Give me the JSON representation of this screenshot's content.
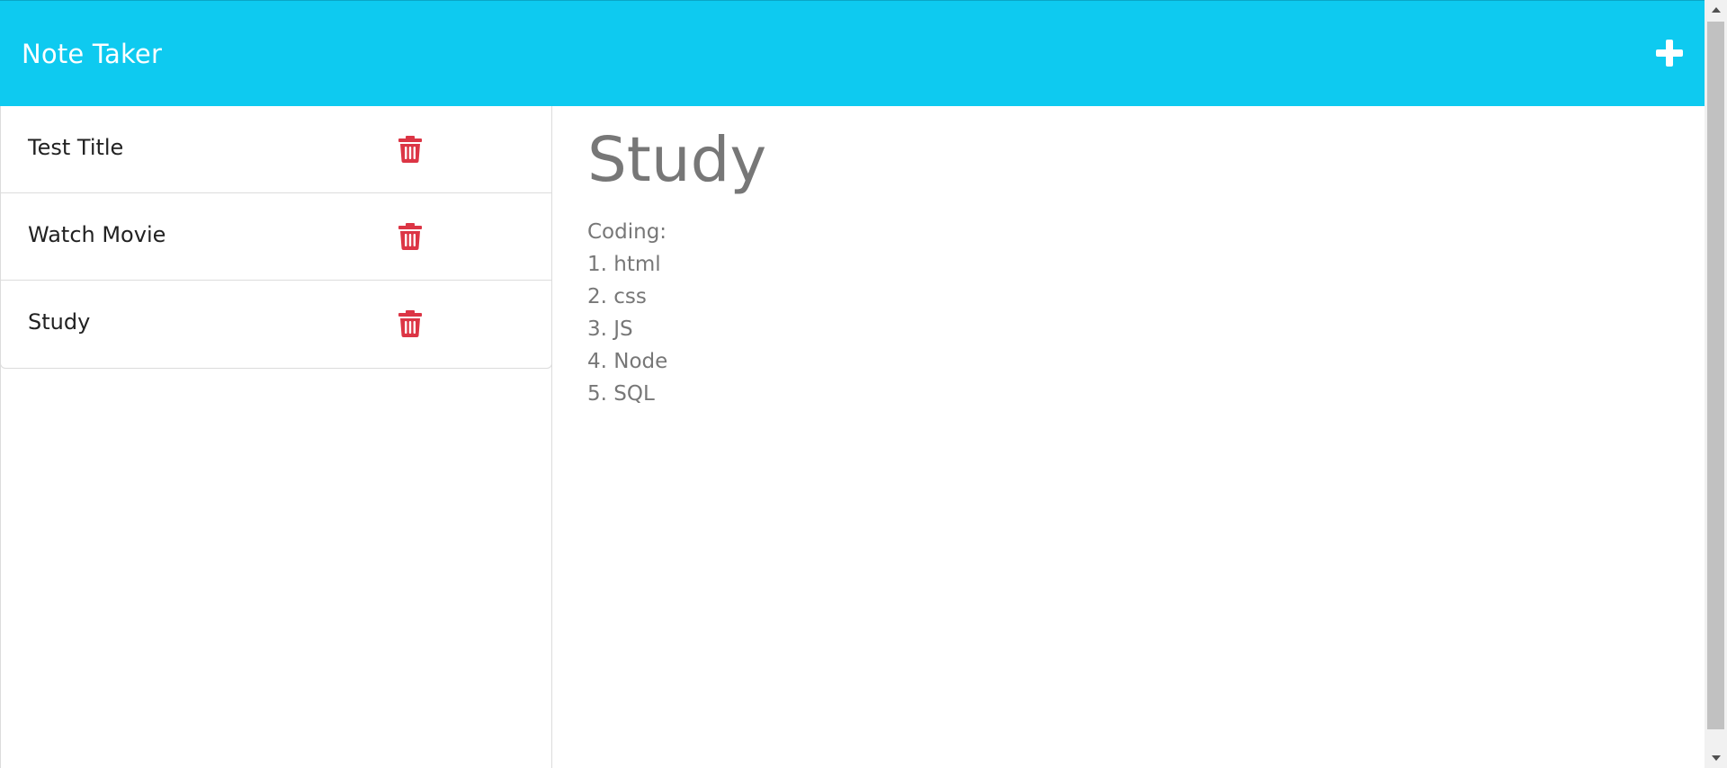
{
  "app": {
    "title": "Note Taker",
    "accent_color": "#0ecaf0",
    "delete_color": "#dc3545"
  },
  "navbar": {
    "new_note_icon": "plus-icon"
  },
  "sidebar": {
    "notes": [
      {
        "title": "Test Title",
        "icon": "trash-icon"
      },
      {
        "title": "Watch Movie",
        "icon": "trash-icon"
      },
      {
        "title": "Study",
        "icon": "trash-icon"
      }
    ]
  },
  "active_note": {
    "title": "Study",
    "lines": [
      "Coding:",
      "1. html",
      "2. css",
      "3. JS",
      "4. Node",
      "5. SQL"
    ]
  }
}
